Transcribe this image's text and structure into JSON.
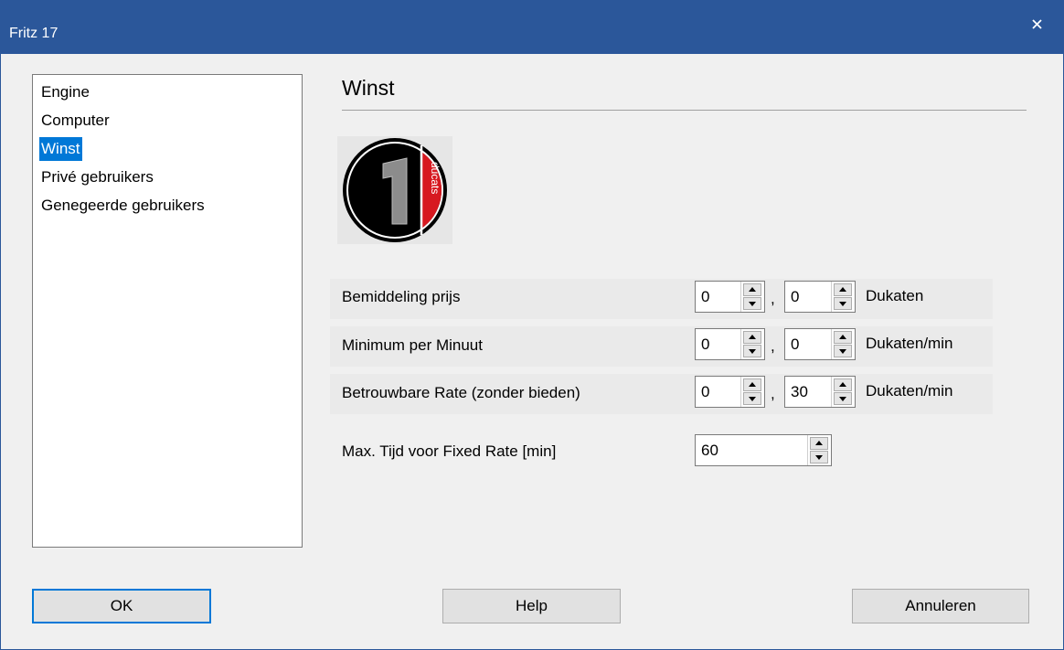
{
  "window": {
    "title": "Fritz 17"
  },
  "nav": {
    "items": [
      {
        "label": "Engine"
      },
      {
        "label": "Computer"
      },
      {
        "label": "Winst",
        "selected": true
      },
      {
        "label": "Privé gebruikers"
      },
      {
        "label": "Genegeerde gebruikers"
      }
    ]
  },
  "section": {
    "title": "Winst"
  },
  "logo": {
    "numeral": "1",
    "text": "ducats",
    "icon": "ducats-coin-icon",
    "accent": "#d71920"
  },
  "fields": {
    "broker_price": {
      "label": "Bemiddeling prijs",
      "whole": "0",
      "sep": ",",
      "fraction": "0",
      "unit": "Dukaten"
    },
    "minimum_per_minute": {
      "label": "Minimum per Minuut",
      "whole": "0",
      "sep": ",",
      "fraction": "0",
      "unit": "Dukaten/min"
    },
    "reliable_rate": {
      "label": "Betrouwbare Rate (zonder bieden)",
      "whole": "0",
      "sep": ",",
      "fraction": "30",
      "unit": "Dukaten/min"
    },
    "max_time": {
      "label": "Max. Tijd voor Fixed Rate [min]",
      "value": "60"
    }
  },
  "buttons": {
    "ok": "OK",
    "help": "Help",
    "cancel": "Annuleren"
  },
  "colors": {
    "titlebar": "#2b579a",
    "selection": "#0078d7",
    "background": "#f0f0f0"
  }
}
